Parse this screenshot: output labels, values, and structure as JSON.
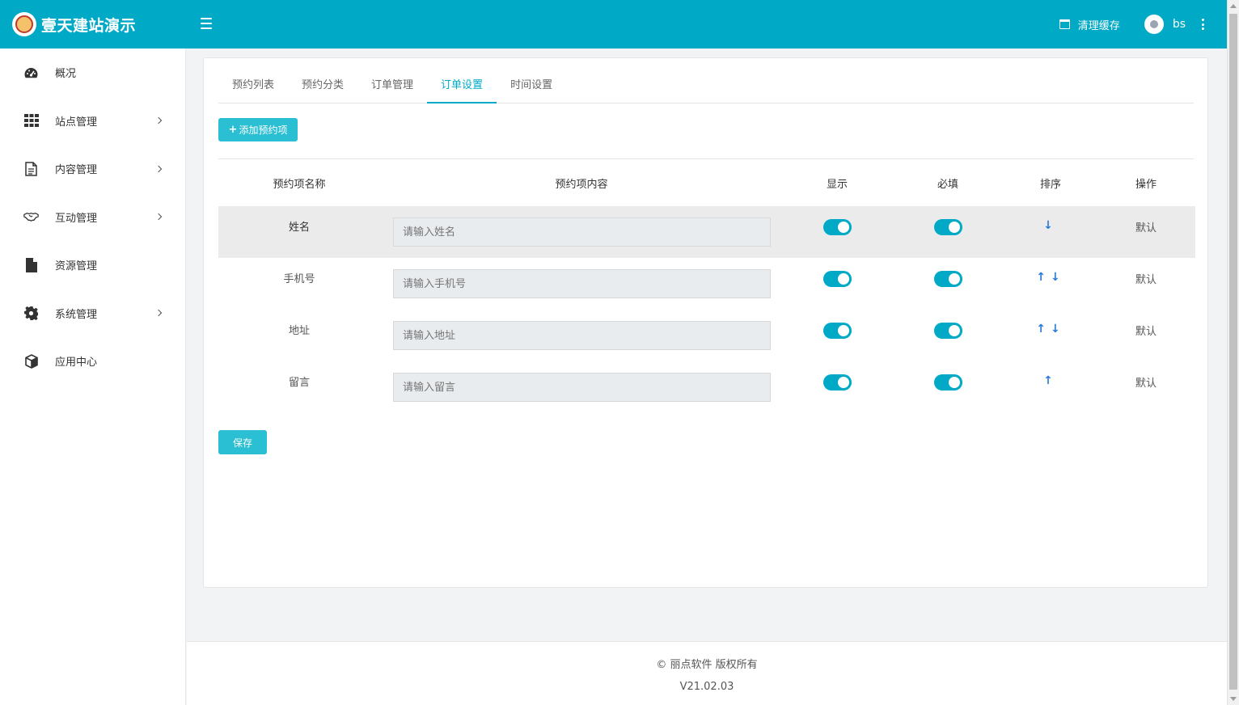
{
  "header": {
    "brand": "壹天建站演示",
    "clear_cache": "清理缓存",
    "username": "bs"
  },
  "sidebar": {
    "items": [
      {
        "label": "概况",
        "icon": "dashboard-icon",
        "has_arrow": false
      },
      {
        "label": "站点管理",
        "icon": "grid-icon",
        "has_arrow": true
      },
      {
        "label": "内容管理",
        "icon": "document-icon",
        "has_arrow": true
      },
      {
        "label": "互动管理",
        "icon": "handshake-icon",
        "has_arrow": true
      },
      {
        "label": "资源管理",
        "icon": "file-icon",
        "has_arrow": false
      },
      {
        "label": "系统管理",
        "icon": "gear-icon",
        "has_arrow": true
      },
      {
        "label": "应用中心",
        "icon": "cube-icon",
        "has_arrow": false
      }
    ]
  },
  "tabs": [
    {
      "label": "预约列表",
      "active": false
    },
    {
      "label": "预约分类",
      "active": false
    },
    {
      "label": "订单管理",
      "active": false
    },
    {
      "label": "订单设置",
      "active": true
    },
    {
      "label": "时间设置",
      "active": false
    }
  ],
  "add_button": "添加预约项",
  "table": {
    "headers": [
      "预约项名称",
      "预约项内容",
      "显示",
      "必填",
      "排序",
      "操作"
    ],
    "rows": [
      {
        "name": "姓名",
        "placeholder": "请输入姓名",
        "show": true,
        "required": true,
        "sort": [
          "↓"
        ],
        "action": "默认"
      },
      {
        "name": "手机号",
        "placeholder": "请输入手机号",
        "show": true,
        "required": true,
        "sort": [
          "↑",
          "↓"
        ],
        "action": "默认"
      },
      {
        "name": "地址",
        "placeholder": "请输入地址",
        "show": true,
        "required": true,
        "sort": [
          "↑",
          "↓"
        ],
        "action": "默认"
      },
      {
        "name": "留言",
        "placeholder": "请输入留言",
        "show": true,
        "required": true,
        "sort": [
          "↑"
        ],
        "action": "默认"
      }
    ]
  },
  "save_button": "保存",
  "footer": {
    "copyright": "© 丽点软件 版权所有",
    "version": "V21.02.03"
  },
  "colors": {
    "primary": "#00aac6",
    "button": "#2bbfd3",
    "sort_arrow": "#2b7bd8"
  }
}
